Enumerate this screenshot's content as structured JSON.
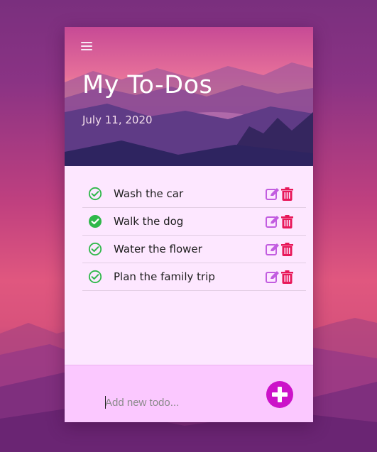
{
  "header": {
    "title": "My To-Dos",
    "date": "July 11, 2020"
  },
  "todos": [
    {
      "label": "Wash the car",
      "done": false
    },
    {
      "label": "Walk the dog",
      "done": true
    },
    {
      "label": "Water the flower",
      "done": false
    },
    {
      "label": "Plan the family trip",
      "done": false
    }
  ],
  "footer": {
    "input_value": "",
    "input_placeholder": "Add new todo..."
  },
  "icons": {
    "menu": "hamburger-icon",
    "check": "check-circle-icon",
    "edit": "edit-icon",
    "delete": "trash-icon",
    "add": "plus-circle-icon"
  },
  "colors": {
    "check_green": "#2fb84a",
    "edit_purple": "#c25ce0",
    "delete_red": "#e8185a",
    "add_button": "#cc13c9",
    "card_bg": "#fde7ff",
    "footer_bg": "#fbc8ff"
  }
}
